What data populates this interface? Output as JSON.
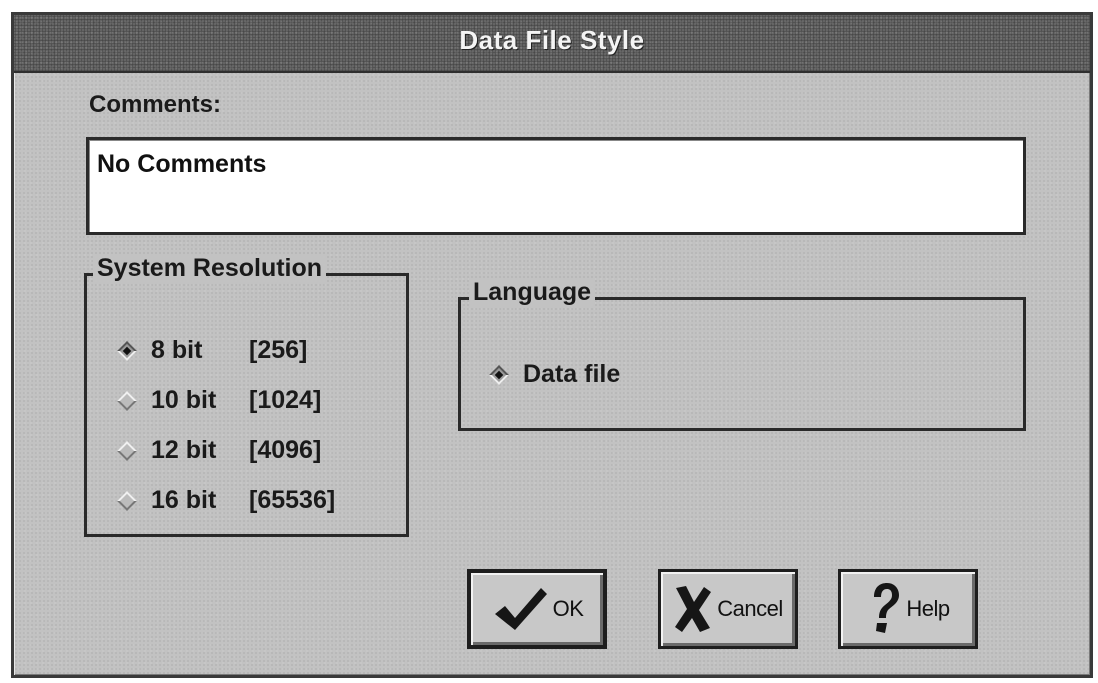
{
  "window": {
    "title": "Data File Style"
  },
  "comments": {
    "label": "Comments:",
    "value": "No Comments"
  },
  "system_resolution": {
    "title": "System Resolution",
    "options": [
      {
        "bits": "8 bit",
        "range": "[256]",
        "selected": true
      },
      {
        "bits": "10 bit",
        "range": "[1024]",
        "selected": false
      },
      {
        "bits": "12 bit",
        "range": "[4096]",
        "selected": false
      },
      {
        "bits": "16 bit",
        "range": "[65536]",
        "selected": false
      }
    ]
  },
  "language": {
    "title": "Language",
    "options": [
      {
        "label": "Data file",
        "selected": true
      }
    ]
  },
  "buttons": {
    "ok": {
      "label": "OK",
      "icon": "checkmark-icon"
    },
    "cancel": {
      "label": "Cancel",
      "icon": "x-icon"
    },
    "help": {
      "label": "Help",
      "icon": "question-mark-icon"
    }
  }
}
